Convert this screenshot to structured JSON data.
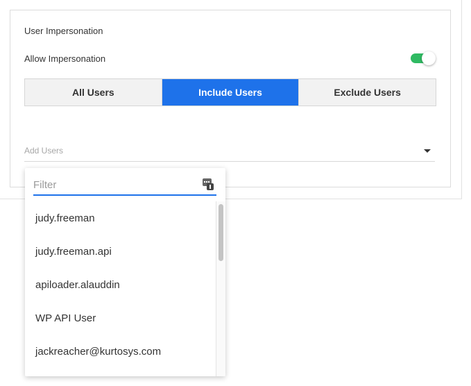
{
  "panel": {
    "section_title": "User Impersonation",
    "allow_label": "Allow Impersonation",
    "allow_enabled": true
  },
  "segments": [
    {
      "label": "All Users",
      "active": false
    },
    {
      "label": "Include Users",
      "active": true
    },
    {
      "label": "Exclude Users",
      "active": false
    }
  ],
  "add_users": {
    "placeholder": "Add Users"
  },
  "dropdown": {
    "filter_placeholder": "Filter",
    "items": [
      "judy.freeman",
      "judy.freeman.api",
      "apiloader.alauddin",
      "WP API User",
      "jackreacher@kurtosys.com"
    ]
  },
  "colors": {
    "accent": "#1e72ea",
    "toggle_on": "#2fba62"
  },
  "icons": {
    "filter": "filter-list-icon",
    "caret": "caret-down-icon"
  }
}
